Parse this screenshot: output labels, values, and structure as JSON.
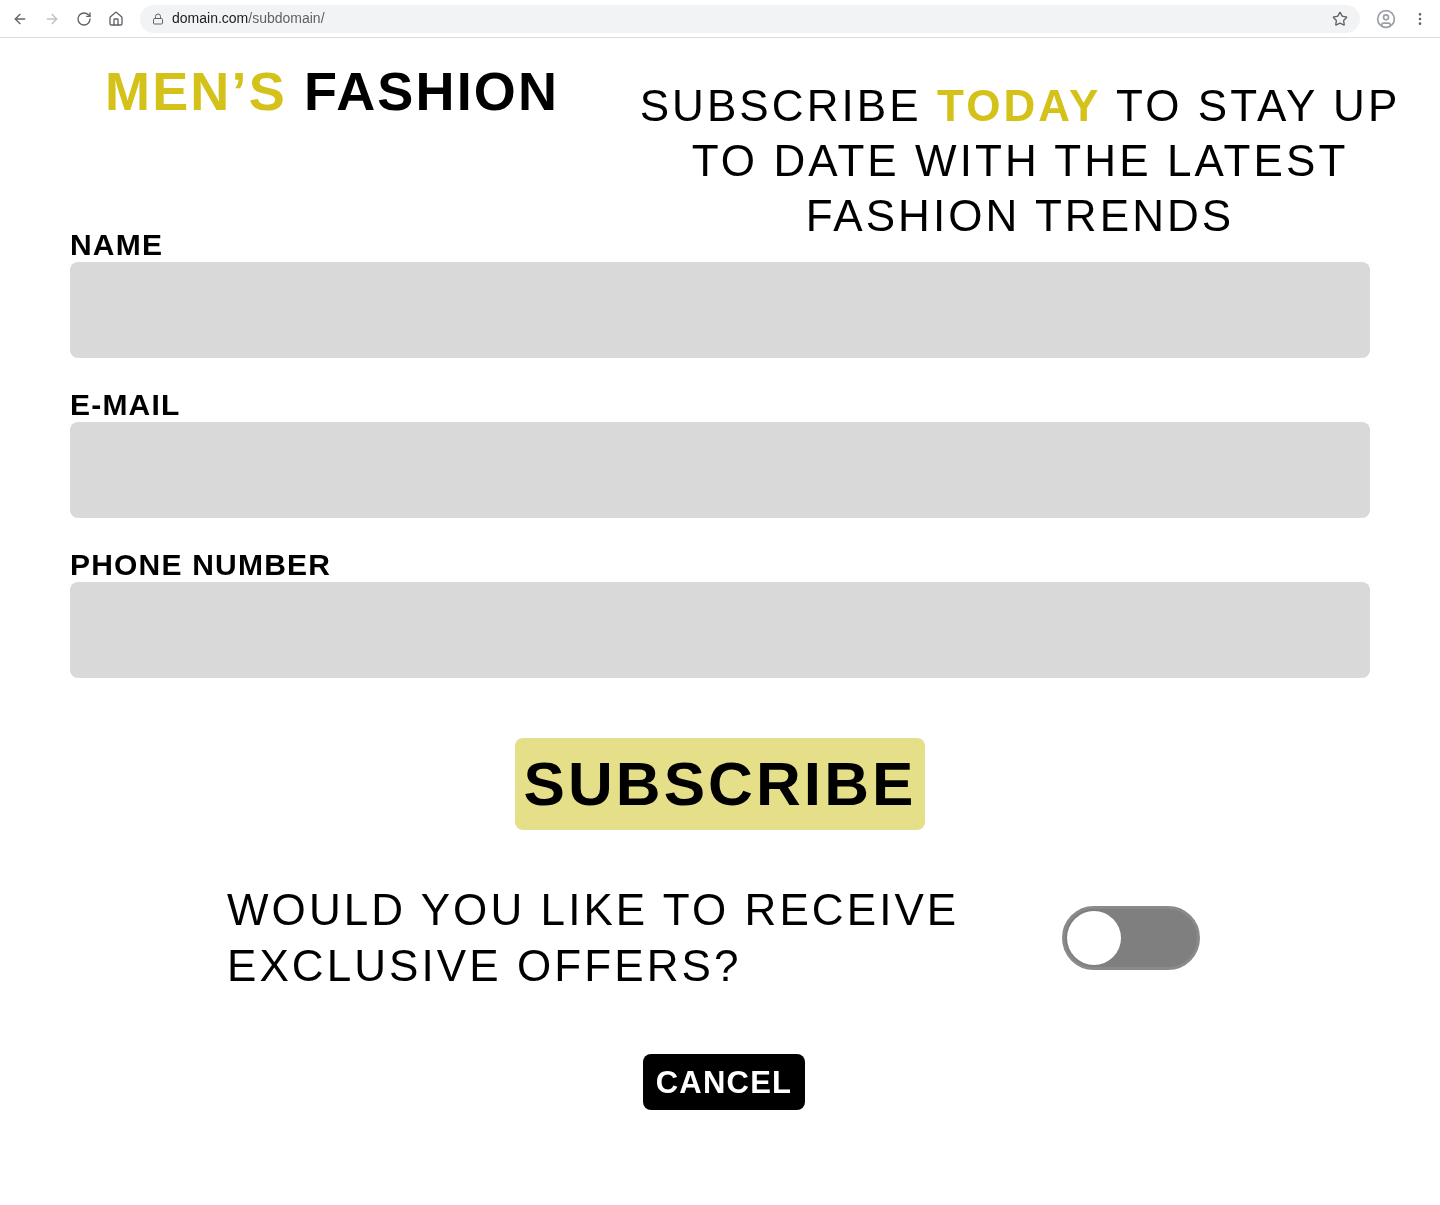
{
  "browser": {
    "url": {
      "host": "domain.com",
      "path": "/subdomain/"
    }
  },
  "title": [
    {
      "text": "MEN’S",
      "highlight": true
    },
    {
      "text": "FASHION",
      "highlight": false
    }
  ],
  "tagline": [
    {
      "text": "SUBSCRIBE",
      "highlight": false
    },
    {
      "text": "TODAY",
      "highlight": true
    },
    {
      "text": "TO STAY UP TO DATE WITH THE LATEST FASHION TRENDS",
      "highlight": false
    }
  ],
  "fields": [
    {
      "label": "NAME"
    },
    {
      "label": "E-MAIL"
    },
    {
      "label": "PHONE NUMBER"
    }
  ],
  "subscribe_button": "SUBSCRIBE",
  "offers": {
    "question": "WOULD YOU LIKE TO RECEIVE EXCLUSIVE OFFERS?",
    "on": false
  },
  "cancel_button": "CANCEL"
}
